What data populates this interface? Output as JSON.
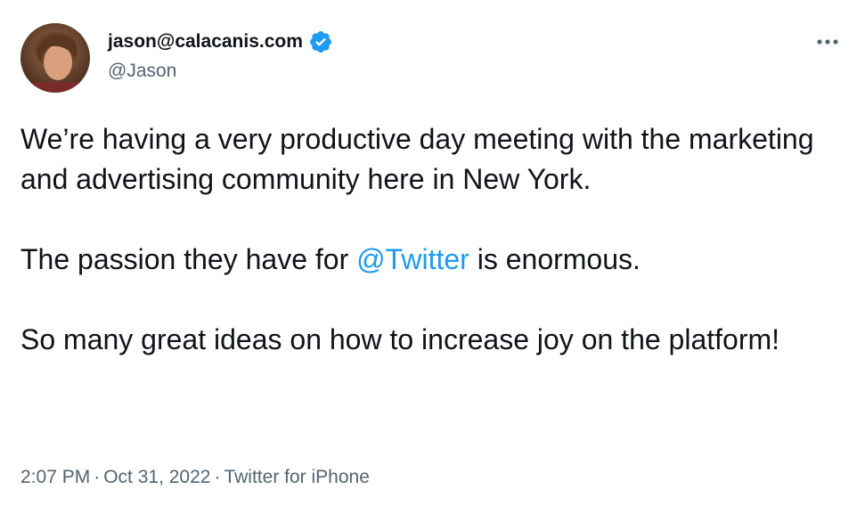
{
  "author": {
    "display_name": "jason@calacanis.com",
    "handle": "@Jason",
    "verified": true,
    "verified_icon": "verified-badge-icon"
  },
  "tweet": {
    "line1": "We’re having a very productive day meeting with the marketing and advertising community here in New York.",
    "line2_before": "The passion they have for ",
    "line2_mention": "@Twitter",
    "line2_after": " is enormous.",
    "line3": "So many great ideas on how to increase joy on the platform!"
  },
  "meta": {
    "time": "2:07 PM",
    "separator": "·",
    "date": "Oct 31, 2022",
    "source": "Twitter for iPhone"
  },
  "colors": {
    "accent": "#1d9bf0",
    "text": "#0f1419",
    "secondary": "#536471"
  }
}
